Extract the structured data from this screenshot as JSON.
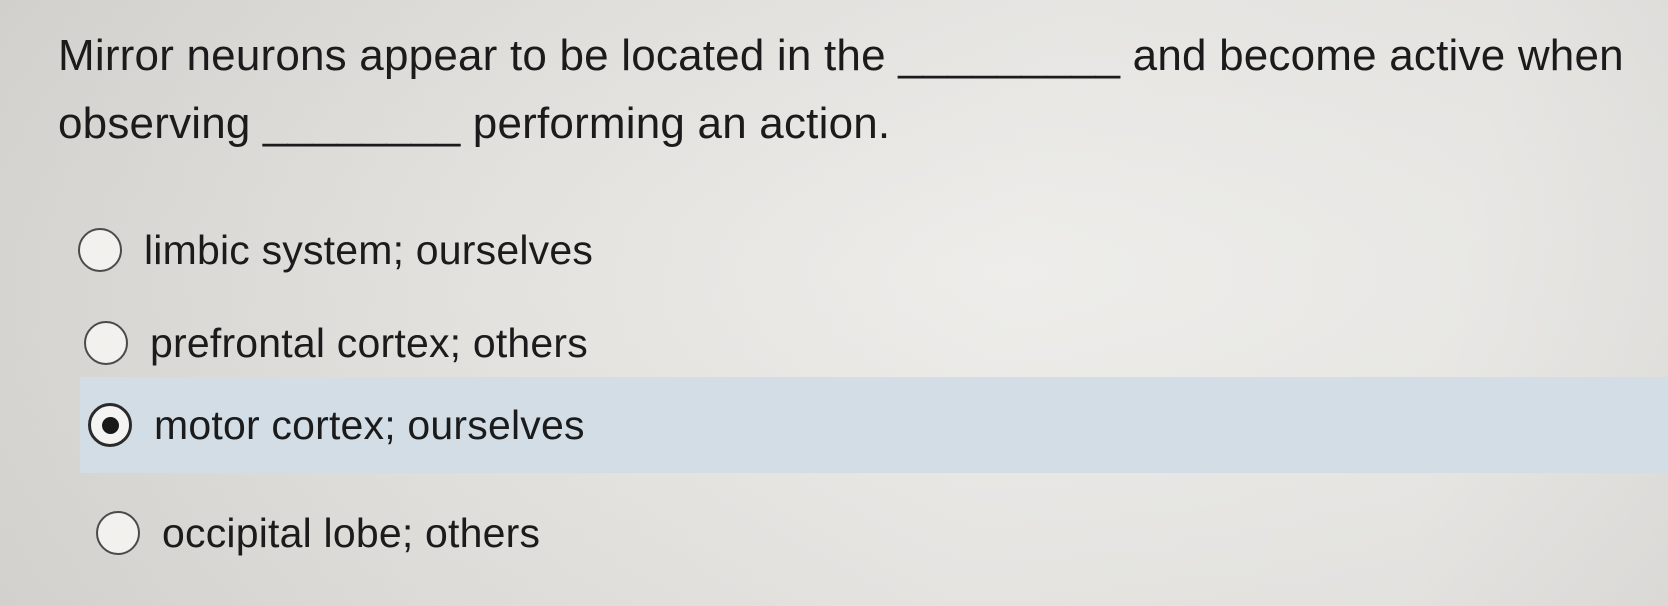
{
  "question": {
    "line1": "Mirror neurons appear to be located in the _________ and become active when",
    "line2": "observing ________ performing an action."
  },
  "options": [
    {
      "label": "limbic system; ourselves",
      "selected": false
    },
    {
      "label": "prefrontal cortex; others",
      "selected": false
    },
    {
      "label": "motor cortex; ourselves",
      "selected": true
    },
    {
      "label": "occipital lobe; others",
      "selected": false
    }
  ],
  "colors": {
    "background": "#e8e7e4",
    "selected_highlight": "#d3dde5",
    "text": "#1b1b1b"
  },
  "icons": {
    "unselected": "radio-empty-icon",
    "selected": "radio-filled-icon"
  }
}
